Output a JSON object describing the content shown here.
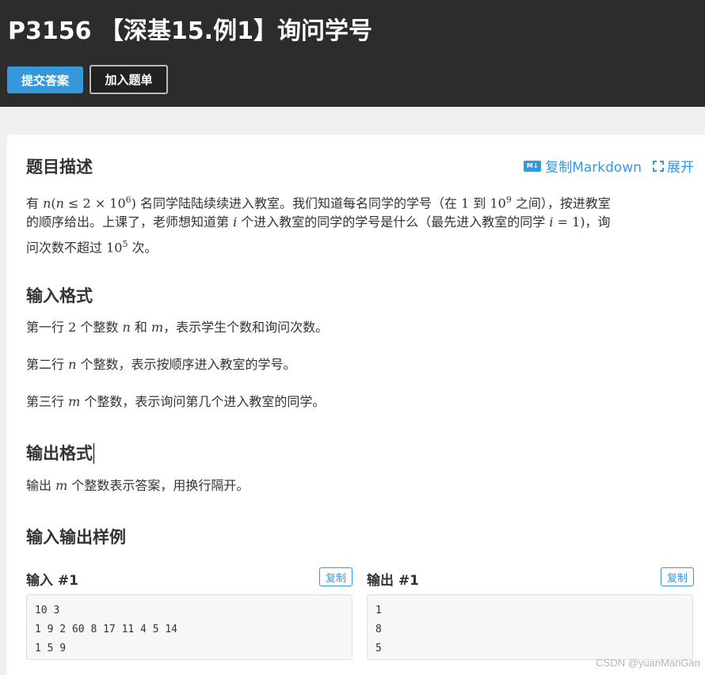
{
  "header": {
    "title": "P3156 【深基15.例1】询问学号",
    "submit_label": "提交答案",
    "add_to_list_label": "加入题单"
  },
  "tools": {
    "md_icon_text": "M↓",
    "copy_markdown_label": "复制Markdown",
    "expand_label": "展开"
  },
  "description": {
    "heading": "题目描述",
    "line1": {
      "a": "有 ",
      "math_n": "n",
      "b": "(",
      "math_n2": "n",
      "c": " ≤ 2 × 10",
      "sup6": "6",
      "d": ") 名同学陆陆续续进入教室。我们知道每名同学的学号（在 ",
      "one": "1",
      "e": " 到 10",
      "sup9": "9",
      "f": " 之间），按进教室"
    },
    "line2": {
      "a": "的顺序给出。上课了，老师想知道第 ",
      "math_i": "i",
      "b": " 个进入教室的同学的学号是什么（最先进入教室的同学 ",
      "math_i2": "i",
      "c": " = 1)，询"
    },
    "line3": {
      "a": "问次数不超过 10",
      "sup5": "5",
      "b": " 次。"
    }
  },
  "input_format": {
    "heading": "输入格式",
    "line1": {
      "a": "第一行 ",
      "two": "2",
      "b": " 个整数 ",
      "n": "n",
      "c": " 和 ",
      "m": "m",
      "d": "，表示学生个数和询问次数。"
    },
    "line2": {
      "a": "第二行 ",
      "n": "n",
      "b": " 个整数，表示按顺序进入教室的学号。"
    },
    "line3": {
      "a": "第三行 ",
      "m": "m",
      "b": " 个整数，表示询问第几个进入教室的同学。"
    }
  },
  "output_format": {
    "heading": "输出格式",
    "line1": {
      "a": "输出 ",
      "m": "m",
      "b": " 个整数表示答案，用换行隔开。"
    }
  },
  "samples": {
    "heading": "输入输出样例",
    "input_label": "输入 #1",
    "output_label": "输出 #1",
    "copy_label": "复制",
    "input_lines": [
      "10 3",
      "1 9 2 60 8 17 11 4 5 14",
      "1 5 9"
    ],
    "output_lines": [
      "1",
      "8",
      "5"
    ]
  },
  "watermark": "CSDN @yuanManGan",
  "colors": {
    "header_bg": "#2c2c2c",
    "accent": "#3498db",
    "page_bg": "#efefef"
  }
}
